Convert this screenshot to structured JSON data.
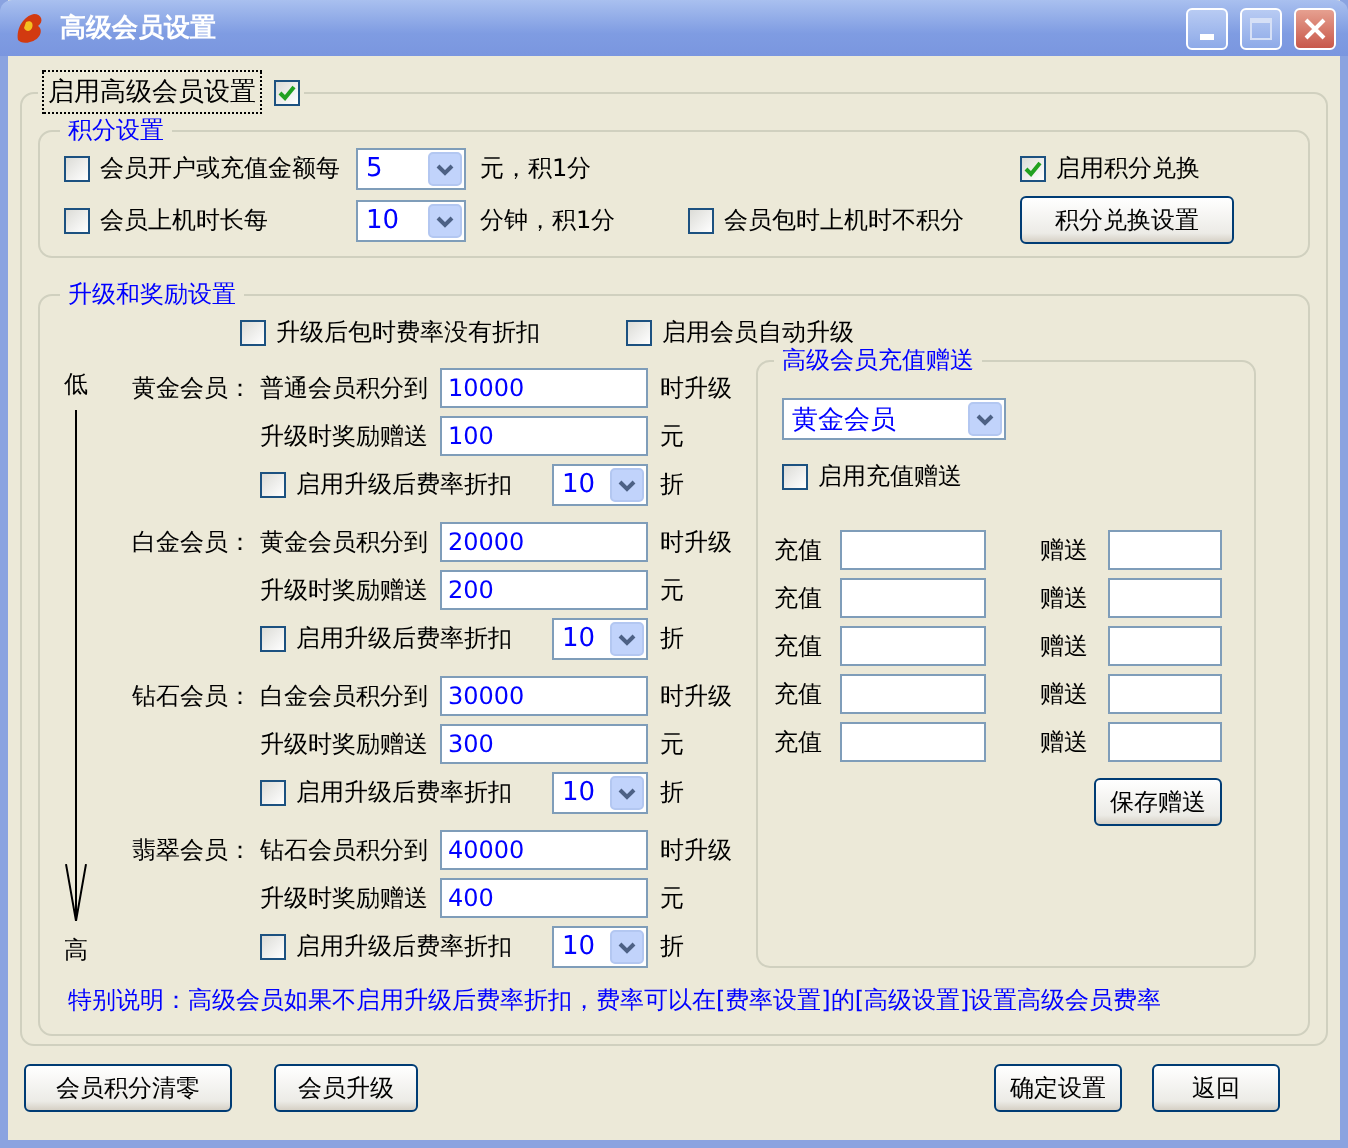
{
  "window": {
    "title": "高级会员设置"
  },
  "enable_advanced": {
    "label": "启用高级会员设置",
    "checked": true
  },
  "points": {
    "title": "积分设置",
    "recharge": {
      "label": "会员开户或充值金额每",
      "checked": false,
      "value": "5",
      "suffix": "元，积1分"
    },
    "online": {
      "label": "会员上机时长每",
      "checked": false,
      "value": "10",
      "suffix": "分钟，积1分"
    },
    "package_no_points": {
      "label": "会员包时上机时不积分",
      "checked": false
    },
    "exchange": {
      "label": "启用积分兑换",
      "checked": true
    },
    "exchange_button": "积分兑换设置"
  },
  "upgrade": {
    "title": "升级和奖励设置",
    "no_discount": {
      "label": "升级后包时费率没有折扣",
      "checked": false
    },
    "auto_upgrade": {
      "label": "启用会员自动升级",
      "checked": false
    },
    "scale_low": "低",
    "scale_high": "高",
    "tiers": [
      {
        "name": "黄金会员：",
        "condition": "普通会员积分到",
        "points": "10000",
        "points_suffix": "时升级",
        "reward_label": "升级时奖励赠送",
        "reward": "100",
        "reward_suffix": "元",
        "discount": {
          "label": "启用升级后费率折扣",
          "checked": false,
          "value": "10",
          "suffix": "折"
        }
      },
      {
        "name": "白金会员：",
        "condition": "黄金会员积分到",
        "points": "20000",
        "points_suffix": "时升级",
        "reward_label": "升级时奖励赠送",
        "reward": "200",
        "reward_suffix": "元",
        "discount": {
          "label": "启用升级后费率折扣",
          "checked": false,
          "value": "10",
          "suffix": "折"
        }
      },
      {
        "name": "钻石会员：",
        "condition": "白金会员积分到",
        "points": "30000",
        "points_suffix": "时升级",
        "reward_label": "升级时奖励赠送",
        "reward": "300",
        "reward_suffix": "元",
        "discount": {
          "label": "启用升级后费率折扣",
          "checked": false,
          "value": "10",
          "suffix": "折"
        }
      },
      {
        "name": "翡翠会员：",
        "condition": "钻石会员积分到",
        "points": "40000",
        "points_suffix": "时升级",
        "reward_label": "升级时奖励赠送",
        "reward": "400",
        "reward_suffix": "元",
        "discount": {
          "label": "启用升级后费率折扣",
          "checked": false,
          "value": "10",
          "suffix": "折"
        }
      }
    ],
    "note": "特别说明：高级会员如果不启用升级后费率折扣，费率可以在[费率设置]的[高级设置]设置高级会员费率"
  },
  "recharge_bonus": {
    "title": "高级会员充值赠送",
    "level": "黄金会员",
    "enable": {
      "label": "启用充值赠送",
      "checked": false
    },
    "rows": [
      {
        "recharge_label": "充值",
        "bonus_label": "赠送"
      },
      {
        "recharge_label": "充值",
        "bonus_label": "赠送"
      },
      {
        "recharge_label": "充值",
        "bonus_label": "赠送"
      },
      {
        "recharge_label": "充值",
        "bonus_label": "赠送"
      },
      {
        "recharge_label": "充值",
        "bonus_label": "赠送"
      }
    ],
    "save_button": "保存赠送"
  },
  "buttons_left": [
    "会员积分清零",
    "会员升级"
  ],
  "buttons_right": [
    "确定设置",
    "返回"
  ]
}
